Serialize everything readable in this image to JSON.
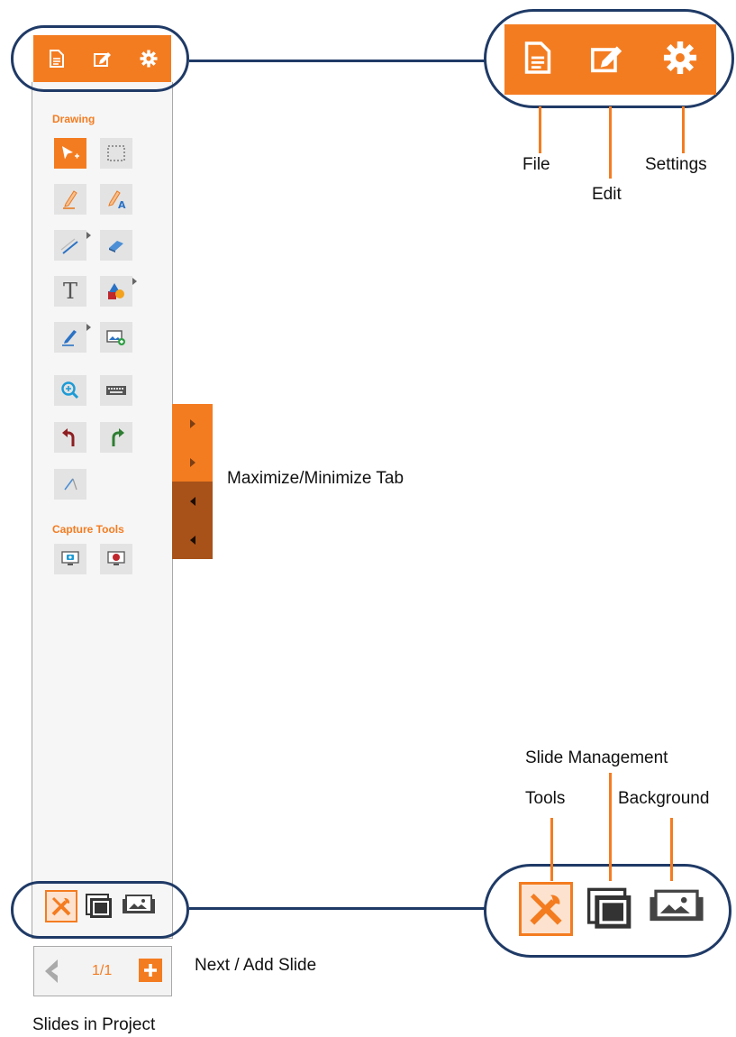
{
  "colors": {
    "accent": "#f47c20",
    "accent_dark": "#a8521a",
    "callout": "#1f3a66"
  },
  "header": {
    "icons": [
      "file-icon",
      "edit-icon",
      "settings-icon"
    ]
  },
  "toolbar": {
    "drawing_label": "Drawing",
    "capture_label": "Capture Tools"
  },
  "tools": [
    {
      "name": "select-tool",
      "icon": "arrow-cursor-icon",
      "active": true
    },
    {
      "name": "region-select-tool",
      "icon": "dashed-rect-icon"
    },
    {
      "name": "pen-tool",
      "icon": "pencil-icon"
    },
    {
      "name": "handwriting-tool",
      "icon": "pencil-text-icon"
    },
    {
      "name": "line-tool",
      "icon": "line-icon"
    },
    {
      "name": "eraser-tool",
      "icon": "eraser-icon"
    },
    {
      "name": "text-tool",
      "icon": "text-icon",
      "glyph": "T"
    },
    {
      "name": "shapes-tool",
      "icon": "shapes-icon"
    },
    {
      "name": "highlighter-tool",
      "icon": "highlighter-icon"
    },
    {
      "name": "insert-image-tool",
      "icon": "image-add-icon"
    },
    {
      "name": "zoom-tool",
      "icon": "zoom-icon"
    },
    {
      "name": "keyboard-tool",
      "icon": "keyboard-icon"
    },
    {
      "name": "undo-tool",
      "icon": "undo-icon"
    },
    {
      "name": "redo-tool",
      "icon": "redo-icon"
    },
    {
      "name": "laser-tool",
      "icon": "pointer-stick-icon"
    },
    {
      "name": "screenshot-tool",
      "icon": "camera-monitor-icon"
    },
    {
      "name": "screen-record-tool",
      "icon": "record-monitor-icon"
    }
  ],
  "slide_nav": {
    "counter": "1/1"
  },
  "callouts": {
    "file": "File",
    "edit": "Edit",
    "settings": "Settings",
    "max_min_tab": "Maximize/Minimize Tab",
    "slide_management": "Slide Management",
    "tools": "Tools",
    "background": "Background",
    "next_add_slide": "Next / Add Slide",
    "slides_in_project": "Slides in Project"
  }
}
